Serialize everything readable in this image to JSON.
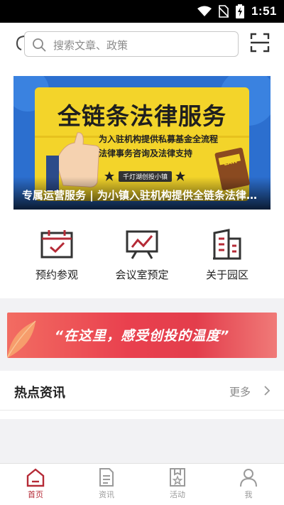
{
  "status_bar": {
    "time": "1:51"
  },
  "search": {
    "placeholder": "搜索文章、政策"
  },
  "banner": {
    "headline": "全链条法律服务",
    "subline_1": "为入驻机构提供私募基金全流程",
    "subline_2": "法律事务咨询及法律支持",
    "tag": "千灯湖创投小镇",
    "badge": "LAW",
    "caption": "专属运营服务 | 为小镇入驻机构提供全链条法律服务"
  },
  "quick_actions": [
    {
      "label": "预约参观",
      "icon": "calendar-check-icon"
    },
    {
      "label": "会议室预定",
      "icon": "presentation-board-icon"
    },
    {
      "label": "关于园区",
      "icon": "building-icon"
    }
  ],
  "promo": {
    "text": "“在这里，感受创投的温度”"
  },
  "news": {
    "title": "热点资讯",
    "more_label": "更多"
  },
  "bottom_nav": [
    {
      "label": "首页",
      "icon": "home-icon",
      "active": true
    },
    {
      "label": "资讯",
      "icon": "document-icon",
      "active": false
    },
    {
      "label": "活动",
      "icon": "bookmark-star-icon",
      "active": false
    },
    {
      "label": "我",
      "icon": "user-icon",
      "active": false
    }
  ],
  "colors": {
    "accent": "#b52a36",
    "banner_yellow": "#f3d42a",
    "promo_red": "#e9404e"
  }
}
